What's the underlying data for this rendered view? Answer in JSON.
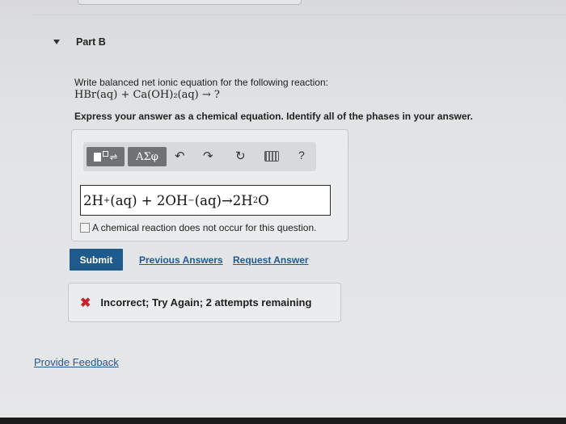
{
  "part": {
    "title": "Part B"
  },
  "question": {
    "prompt": "Write balanced net ionic equation for the following reaction:",
    "reaction": "HBr(aq) + Ca(OH)₂(aq) → ?",
    "instruction": "Express your answer as a chemical equation. Identify all of the phases in your answer."
  },
  "toolbar": {
    "template_button": "templates-icon",
    "greek_label": "ΑΣφ",
    "icons": [
      "undo-icon",
      "redo-icon",
      "reset-icon",
      "keyboard-icon"
    ],
    "help_label": "?"
  },
  "answer": {
    "t1": "2H",
    "s1": "+",
    "t2": "(aq) + 2OH",
    "s2": "−",
    "t3": "(aq)→2H",
    "s3": "2",
    "t4": "O"
  },
  "no_reaction_label": "A chemical reaction does not occur for this question.",
  "actions": {
    "submit": "Submit",
    "previous_answers": "Previous Answers",
    "request_answer": "Request Answer"
  },
  "feedback": {
    "icon": "✖",
    "status_color": "#c4262e",
    "message": "Incorrect; Try Again; 2 attempts remaining"
  },
  "footer": {
    "provide_feedback": "Provide Feedback"
  },
  "colors": {
    "accent": "#1f5a8c",
    "link": "#24598c"
  }
}
